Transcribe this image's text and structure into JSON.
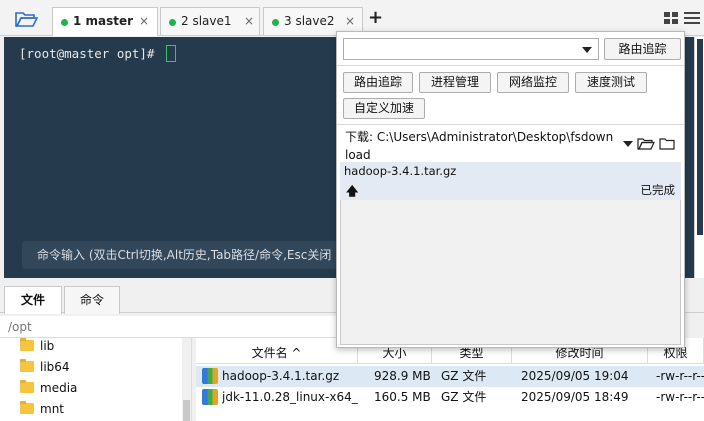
{
  "tabs": [
    {
      "label": "1 master",
      "active": true,
      "status_color": "#22b14c"
    },
    {
      "label": "2 slave1",
      "active": false,
      "status_color": "#22b14c"
    },
    {
      "label": "3 slave2",
      "active": false,
      "status_color": "#22b14c"
    }
  ],
  "tab_close_glyph": "×",
  "add_tab_glyph": "+",
  "icons": {
    "open_folder": "folder-open-icon",
    "grid": "grid-view-icon",
    "menu": "hamburger-menu-icon",
    "close": "close-icon",
    "add": "plus-icon"
  },
  "terminal": {
    "prompt": "[root@master opt]# ",
    "background": "#263a4d",
    "cursor_color": "#3fbf6a",
    "command_hint": "命令输入 (双击Ctrl切换,Alt历史,Tab路径/命令,Esc关闭"
  },
  "bottom_tabs": [
    {
      "label": "文件",
      "active": true
    },
    {
      "label": "命令",
      "active": false
    }
  ],
  "path": "/opt",
  "tree": [
    "lib",
    "lib64",
    "media",
    "mnt"
  ],
  "file_table": {
    "columns": [
      "文件名 ^",
      "大小",
      "类型",
      "修改时间",
      "权限"
    ],
    "rows": [
      {
        "name": "hadoop-3.4.1.tar.gz",
        "size": "928.9 MB",
        "type": "GZ 文件",
        "modified": "2025/09/05 19:04",
        "perm": "-rw-r--r--",
        "selected": true
      },
      {
        "name": "jdk-11.0.28_linux-x64_...",
        "size": "160.5 MB",
        "type": "GZ 文件",
        "modified": "2025/09/05 18:49",
        "perm": "-rw-r--r--",
        "selected": false
      }
    ]
  },
  "popup": {
    "combo_value": "",
    "trace_button": "路由追踪",
    "tools": [
      "路由追踪",
      "进程管理",
      "网络监控",
      "速度测试",
      "自定义加速"
    ],
    "download_label": "下载: C:\\Users\\Administrator\\Desktop\\fsdownload",
    "transfer": {
      "name": "hadoop-3.4.1.tar.gz",
      "direction_glyph": "🡅",
      "status": "已完成"
    }
  }
}
